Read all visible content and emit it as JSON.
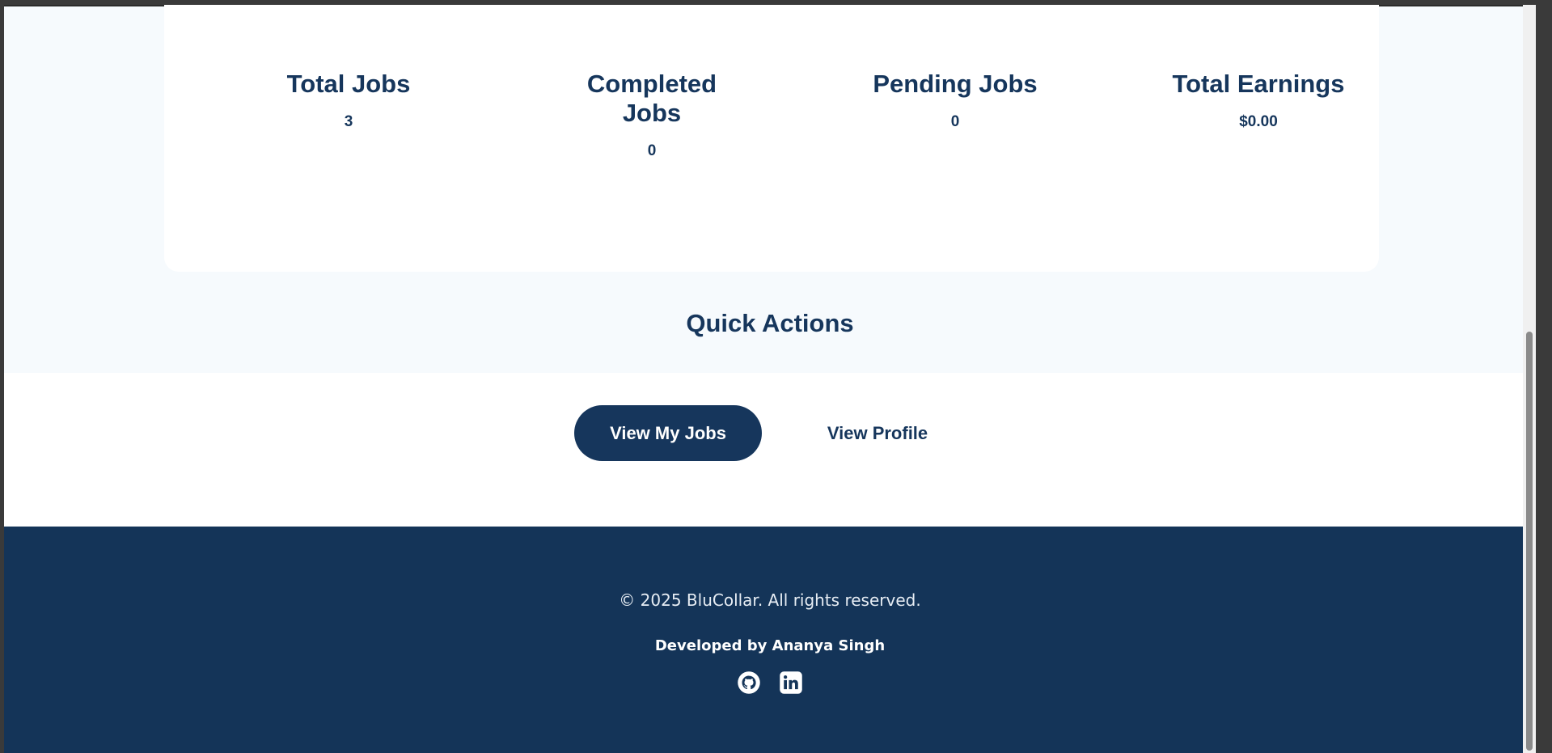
{
  "stats": {
    "total_jobs": {
      "label": "Total Jobs",
      "value": "3"
    },
    "completed_jobs": {
      "label": "Completed Jobs",
      "value": "0"
    },
    "pending_jobs": {
      "label": "Pending Jobs",
      "value": "0"
    },
    "total_earnings": {
      "label": "Total Earnings",
      "value": "$0.00"
    }
  },
  "quick_actions": {
    "title": "Quick Actions",
    "view_jobs_label": "View My Jobs",
    "view_profile_label": "View Profile"
  },
  "footer": {
    "copyright": "© 2025 BluCollar. All rights reserved.",
    "developed_by": "Developed by",
    "developer_name": "Ananya Singh",
    "social": [
      {
        "name": "github-icon"
      },
      {
        "name": "linkedin-icon"
      }
    ]
  },
  "colors": {
    "brand_navy": "#16365c",
    "footer_bg": "#143458",
    "page_bg": "#f6fafd"
  }
}
